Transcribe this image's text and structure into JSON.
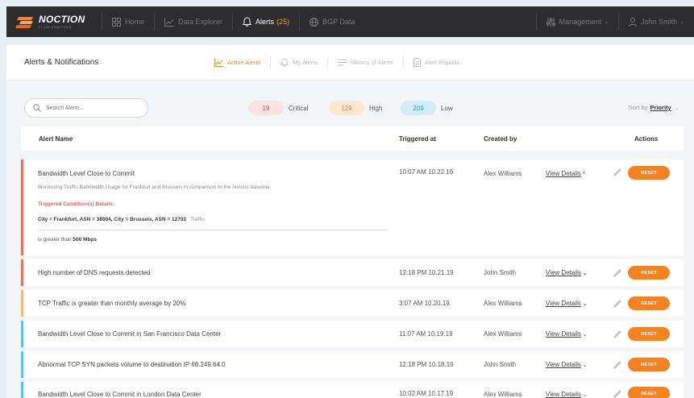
{
  "app": {
    "logo_name": "NOCTION",
    "logo_sub": "FLOW ANALYZER"
  },
  "nav": {
    "home": "Home",
    "data_explorer": "Data Explorer",
    "alerts": "Alerts",
    "alerts_count": "(25)",
    "bgp_data": "BGP Data",
    "management": "Management",
    "user": "John Smith"
  },
  "header": {
    "title": "Alerts & Notifications",
    "tabs": [
      "Active Alerts",
      "My Alerts",
      "History of Alerts",
      "Alert Reports"
    ]
  },
  "filters": {
    "search_placeholder": "Search Alerts...",
    "critical_count": "19",
    "critical_label": "Critical",
    "high_count": "129",
    "high_label": "High",
    "low_count": "209",
    "low_label": "Low",
    "sort_label": "Sort by",
    "sort_value": "Priority"
  },
  "colors": {
    "critical": "#f26b5b",
    "high": "#f8b878",
    "low": "#5bc4e6",
    "accent": "#f58220"
  },
  "table": {
    "columns": [
      "Alert Name",
      "Triggered at",
      "Created by",
      "Actions"
    ],
    "view_details_label": "View Details",
    "reset_label": "RESET",
    "rows": [
      {
        "name": "Bandwidth Level Close to Commit",
        "time": "10:07 AM 10.22.19",
        "creator": "Alex Williams",
        "severity": "critical",
        "expanded": true
      },
      {
        "name": "High number of DNS requests detected",
        "time": "12:18 PM 10.21.19",
        "creator": "John Smith",
        "severity": "critical"
      },
      {
        "name": "TCP Traffic is greater than monthly average by 20%",
        "time": "3:07 AM 10.20.19",
        "creator": "Alex Williams",
        "severity": "high"
      },
      {
        "name": "Bandwidth Level Close to Commit in San Francisco Data Center",
        "time": "11:07 AM 10.19.19",
        "creator": "Alex Williams",
        "severity": "low"
      },
      {
        "name": "Abnormal TCP SYN packets volume to destination IP 66.249.64.0",
        "time": "12:18 PM 10.18.19",
        "creator": "John Smith",
        "severity": "low"
      },
      {
        "name": "Bandwidth Level Close to Commit in London Data Center",
        "time": "10:02 AM 10.17.19",
        "creator": "Alex Williams",
        "severity": "low"
      }
    ]
  },
  "expanded_detail": {
    "description": "Monitoring Traffic Bandwidth Usage for Frankfurt and Brussels in comparison to the historic baseline.",
    "conditions_title": "Triggered Condition(s) Details:",
    "rule": "City = Frankfurt, ASN = 38904, City = Brussels, ASN = 12702",
    "rule_tag": "Traffic",
    "operator_text": "is greater than",
    "threshold": "500 Mbps"
  }
}
